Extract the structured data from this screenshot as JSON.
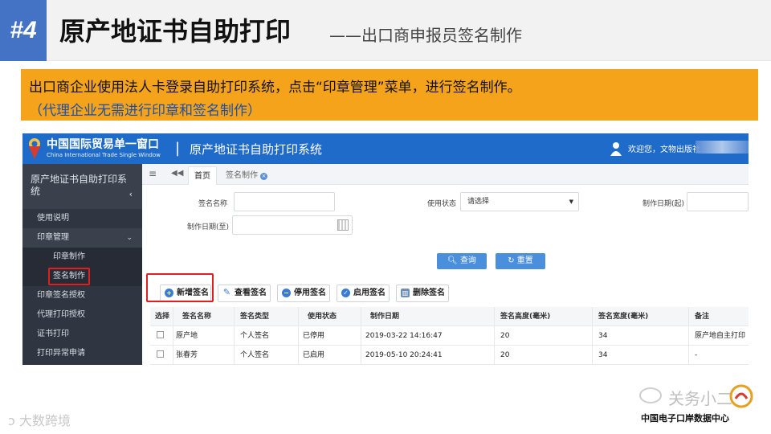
{
  "slide": {
    "step_badge": "#4",
    "title": "原产地证书自助打印",
    "subtitle": "——出口商申报员签名制作",
    "instruction_line1": "出口商企业使用法人卡登录自助打印系统，点击“印章管理”菜单，进行签名制作。",
    "instruction_line2": "（代理企业无需进行印章和签名制作）"
  },
  "app": {
    "brand_cn": "中国国际贸易单一窗口",
    "brand_en": "China International Trade Single Window",
    "separator": "|",
    "system_name": "原产地证书自助打印系统",
    "welcome": "欢迎您，文物出版社",
    "sidebar": {
      "header": "原产地证书自助打印系统",
      "items": [
        {
          "label": "使用说明"
        },
        {
          "label": "印章管理"
        },
        {
          "label": "印章制作"
        },
        {
          "label": "签名制作"
        },
        {
          "label": "印章签名授权"
        },
        {
          "label": "代理打印授权"
        },
        {
          "label": "证书打印"
        },
        {
          "label": "打印异常申请"
        }
      ]
    },
    "tabs": {
      "home": "首页",
      "sign": "签名制作",
      "close_glyph": "×"
    },
    "form": {
      "sign_name_label": "签名名称",
      "status_label": "使用状态",
      "status_value": "请选择",
      "date_from_label": "制作日期(起)",
      "date_to_label": "制作日期(至)"
    },
    "buttons": {
      "query": "查询",
      "reset": "重置",
      "new_sign": "新增签名",
      "view_sign": "查看签名",
      "disable_sign": "停用签名",
      "enable_sign": "启用签名",
      "delete_sign": "删除签名"
    },
    "table": {
      "headers": [
        "选择",
        "签名名称",
        "签名类型",
        "使用状态",
        "制作日期",
        "签名高度(毫米)",
        "签名宽度(毫米)",
        "备注"
      ],
      "rows": [
        [
          "",
          "原产地",
          "个人签名",
          "已停用",
          "2019-03-22 14:16:47",
          "20",
          "34",
          "原产地自主打印"
        ],
        [
          "",
          "张春芳",
          "个人签名",
          "已启用",
          "2019-05-10 20:24:41",
          "20",
          "34",
          "-"
        ]
      ]
    }
  },
  "footer": {
    "watermark_left": "大数跨境",
    "watermark_right_name": "关务小二",
    "watermark_right_sub": "中国电子口岸数据中心"
  },
  "colors": {
    "badge": "#4472c4",
    "instruction_bg": "#f5a31a",
    "app_topbar": "#1f6bc9",
    "sidebar_bg": "#2f3541",
    "highlight": "#e02020",
    "primary_button": "#4a8fdc"
  }
}
